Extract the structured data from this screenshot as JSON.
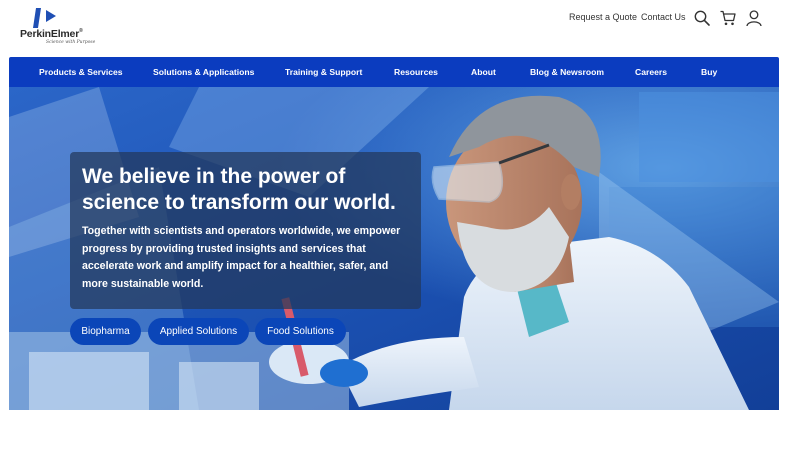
{
  "brand": {
    "name": "PerkinElmer",
    "registered": "®",
    "tagline": "Science with Purpose",
    "color": "#1f4fb4"
  },
  "utility": {
    "request_quote": "Request a Quote",
    "contact_us": "Contact Us",
    "icons": [
      "search-icon",
      "cart-icon",
      "user-icon"
    ]
  },
  "nav": {
    "background": "#0b3cbf",
    "items": [
      "Products & Services",
      "Solutions & Applications",
      "Training & Support",
      "Resources",
      "About",
      "Blog & Newsroom",
      "Careers",
      "Buy"
    ]
  },
  "hero": {
    "headline": "We believe in the power of science to transform our world.",
    "body": "Together with scientists and operators worldwide, we empower progress by providing trusted insights and services that accelerate work and amplify impact for a healthier, safer, and more sustainable world.",
    "buttons": [
      "Biopharma",
      "Applied Solutions",
      "Food Solutions"
    ],
    "button_color": "#0b46b8"
  }
}
